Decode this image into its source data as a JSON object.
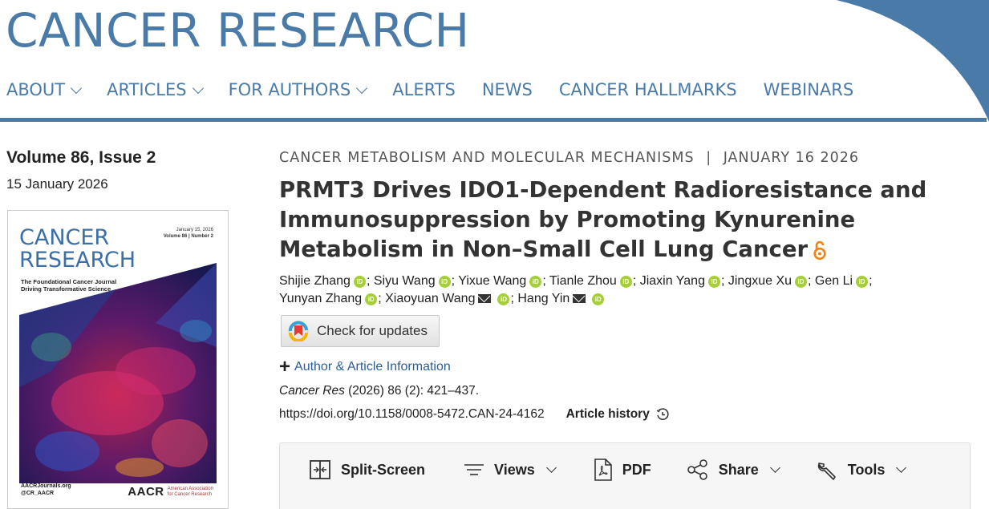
{
  "site": {
    "title": "CANCER RESEARCH"
  },
  "nav": {
    "items": [
      {
        "label": "ABOUT",
        "dropdown": true
      },
      {
        "label": "ARTICLES",
        "dropdown": true
      },
      {
        "label": "FOR AUTHORS",
        "dropdown": true
      },
      {
        "label": "ALERTS",
        "dropdown": false
      },
      {
        "label": "NEWS",
        "dropdown": false
      },
      {
        "label": "CANCER HALLMARKS",
        "dropdown": false
      },
      {
        "label": "WEBINARS",
        "dropdown": false
      }
    ]
  },
  "sidebar": {
    "volume": "Volume 86, Issue 2",
    "date": "15 January 2026",
    "cover": {
      "date_line": "January 15, 2026",
      "vol_line": "Volume 86 | Number 2",
      "title_line1": "CANCER",
      "title_line2": "RESEARCH",
      "subtitle_line1": "The Foundational Cancer Journal",
      "subtitle_line2": "Driving Transformative Science",
      "footer_line1": "AACRJournals.org",
      "footer_line2": "@CR_AACR",
      "logo": "AACR",
      "logo_sub1": "American Association",
      "logo_sub2": "for Cancer Research"
    }
  },
  "article": {
    "category": "CANCER METABOLISM AND MOLECULAR MECHANISMS",
    "separator": "|",
    "date": "JANUARY 16 2026",
    "title": "PRMT3 Drives IDO1-Dependent Radioresistance and Immunosuppression by Promoting Kynurenine Metabolism in Non–Small Cell Lung Cancer",
    "open_access_icon": "open-access-icon",
    "authors": [
      {
        "name": "Shijie Zhang",
        "email": false
      },
      {
        "name": "Siyu Wang",
        "email": false
      },
      {
        "name": "Yixue Wang",
        "email": false
      },
      {
        "name": "Tianle Zhou",
        "email": false
      },
      {
        "name": "Jiaxin Yang",
        "email": false
      },
      {
        "name": "Jingxue Xu",
        "email": false
      },
      {
        "name": "Gen Li",
        "email": false
      },
      {
        "name": "Yunyan Zhang",
        "email": false
      },
      {
        "name": "Xiaoyuan Wang",
        "email": true
      },
      {
        "name": "Hang Yin",
        "email": true
      }
    ],
    "check_updates": "Check for updates",
    "author_info": "Author & Article Information",
    "citation_journal": "Cancer Res",
    "citation_rest": " (2026) 86 (2): 421–437.",
    "doi": "https://doi.org/10.1158/0008-5472.CAN-24-4162",
    "history": "Article history"
  },
  "toolbar": {
    "split": "Split-Screen",
    "views": "Views",
    "pdf": "PDF",
    "share": "Share",
    "tools": "Tools"
  },
  "colors": {
    "brand": "#4a7aa8",
    "link": "#2a5d9a",
    "orcid": "#a6ce39",
    "open_access": "#f68212"
  }
}
